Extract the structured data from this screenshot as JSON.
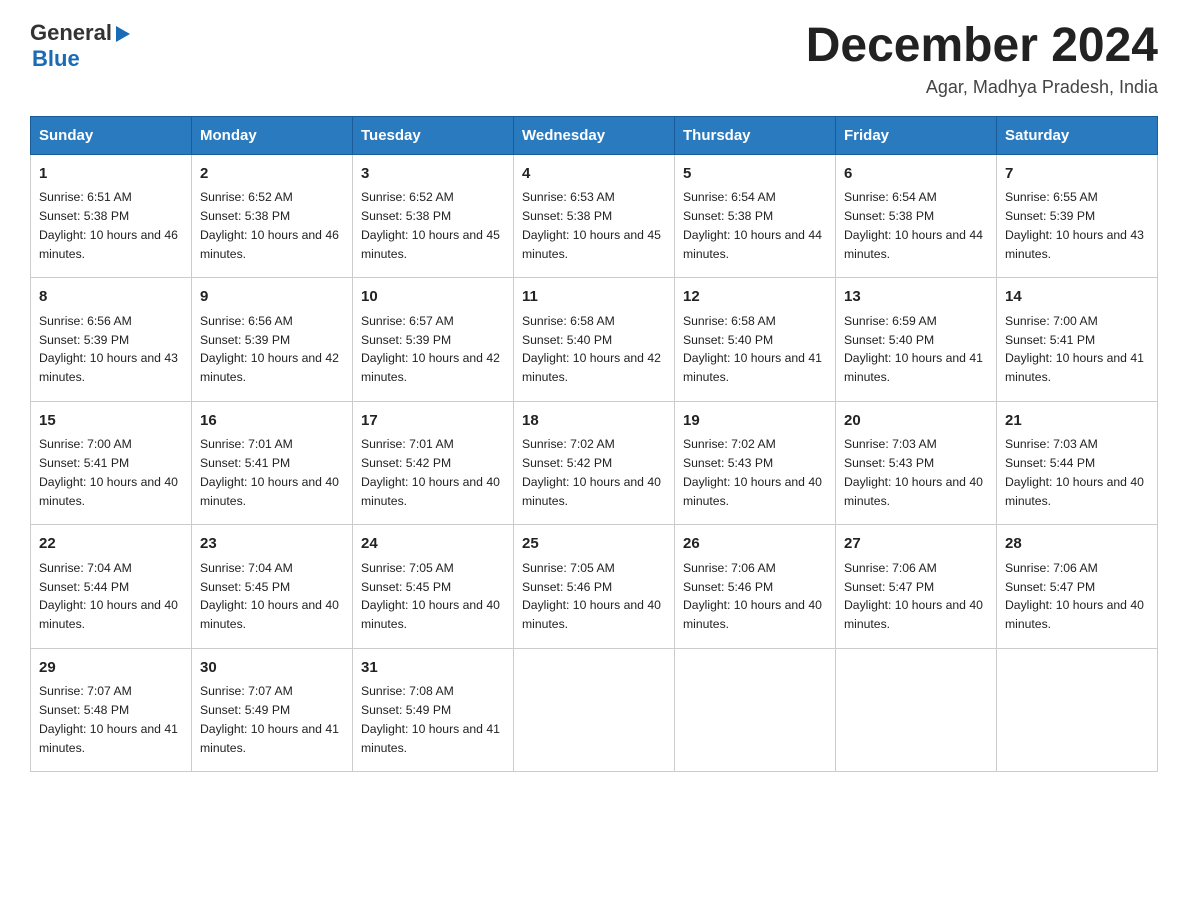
{
  "header": {
    "logo_general": "General",
    "logo_blue": "Blue",
    "month_title": "December 2024",
    "location": "Agar, Madhya Pradesh, India"
  },
  "days_of_week": [
    "Sunday",
    "Monday",
    "Tuesday",
    "Wednesday",
    "Thursday",
    "Friday",
    "Saturday"
  ],
  "weeks": [
    [
      {
        "day": "1",
        "sunrise": "6:51 AM",
        "sunset": "5:38 PM",
        "daylight": "10 hours and 46 minutes."
      },
      {
        "day": "2",
        "sunrise": "6:52 AM",
        "sunset": "5:38 PM",
        "daylight": "10 hours and 46 minutes."
      },
      {
        "day": "3",
        "sunrise": "6:52 AM",
        "sunset": "5:38 PM",
        "daylight": "10 hours and 45 minutes."
      },
      {
        "day": "4",
        "sunrise": "6:53 AM",
        "sunset": "5:38 PM",
        "daylight": "10 hours and 45 minutes."
      },
      {
        "day": "5",
        "sunrise": "6:54 AM",
        "sunset": "5:38 PM",
        "daylight": "10 hours and 44 minutes."
      },
      {
        "day": "6",
        "sunrise": "6:54 AM",
        "sunset": "5:38 PM",
        "daylight": "10 hours and 44 minutes."
      },
      {
        "day": "7",
        "sunrise": "6:55 AM",
        "sunset": "5:39 PM",
        "daylight": "10 hours and 43 minutes."
      }
    ],
    [
      {
        "day": "8",
        "sunrise": "6:56 AM",
        "sunset": "5:39 PM",
        "daylight": "10 hours and 43 minutes."
      },
      {
        "day": "9",
        "sunrise": "6:56 AM",
        "sunset": "5:39 PM",
        "daylight": "10 hours and 42 minutes."
      },
      {
        "day": "10",
        "sunrise": "6:57 AM",
        "sunset": "5:39 PM",
        "daylight": "10 hours and 42 minutes."
      },
      {
        "day": "11",
        "sunrise": "6:58 AM",
        "sunset": "5:40 PM",
        "daylight": "10 hours and 42 minutes."
      },
      {
        "day": "12",
        "sunrise": "6:58 AM",
        "sunset": "5:40 PM",
        "daylight": "10 hours and 41 minutes."
      },
      {
        "day": "13",
        "sunrise": "6:59 AM",
        "sunset": "5:40 PM",
        "daylight": "10 hours and 41 minutes."
      },
      {
        "day": "14",
        "sunrise": "7:00 AM",
        "sunset": "5:41 PM",
        "daylight": "10 hours and 41 minutes."
      }
    ],
    [
      {
        "day": "15",
        "sunrise": "7:00 AM",
        "sunset": "5:41 PM",
        "daylight": "10 hours and 40 minutes."
      },
      {
        "day": "16",
        "sunrise": "7:01 AM",
        "sunset": "5:41 PM",
        "daylight": "10 hours and 40 minutes."
      },
      {
        "day": "17",
        "sunrise": "7:01 AM",
        "sunset": "5:42 PM",
        "daylight": "10 hours and 40 minutes."
      },
      {
        "day": "18",
        "sunrise": "7:02 AM",
        "sunset": "5:42 PM",
        "daylight": "10 hours and 40 minutes."
      },
      {
        "day": "19",
        "sunrise": "7:02 AM",
        "sunset": "5:43 PM",
        "daylight": "10 hours and 40 minutes."
      },
      {
        "day": "20",
        "sunrise": "7:03 AM",
        "sunset": "5:43 PM",
        "daylight": "10 hours and 40 minutes."
      },
      {
        "day": "21",
        "sunrise": "7:03 AM",
        "sunset": "5:44 PM",
        "daylight": "10 hours and 40 minutes."
      }
    ],
    [
      {
        "day": "22",
        "sunrise": "7:04 AM",
        "sunset": "5:44 PM",
        "daylight": "10 hours and 40 minutes."
      },
      {
        "day": "23",
        "sunrise": "7:04 AM",
        "sunset": "5:45 PM",
        "daylight": "10 hours and 40 minutes."
      },
      {
        "day": "24",
        "sunrise": "7:05 AM",
        "sunset": "5:45 PM",
        "daylight": "10 hours and 40 minutes."
      },
      {
        "day": "25",
        "sunrise": "7:05 AM",
        "sunset": "5:46 PM",
        "daylight": "10 hours and 40 minutes."
      },
      {
        "day": "26",
        "sunrise": "7:06 AM",
        "sunset": "5:46 PM",
        "daylight": "10 hours and 40 minutes."
      },
      {
        "day": "27",
        "sunrise": "7:06 AM",
        "sunset": "5:47 PM",
        "daylight": "10 hours and 40 minutes."
      },
      {
        "day": "28",
        "sunrise": "7:06 AM",
        "sunset": "5:47 PM",
        "daylight": "10 hours and 40 minutes."
      }
    ],
    [
      {
        "day": "29",
        "sunrise": "7:07 AM",
        "sunset": "5:48 PM",
        "daylight": "10 hours and 41 minutes."
      },
      {
        "day": "30",
        "sunrise": "7:07 AM",
        "sunset": "5:49 PM",
        "daylight": "10 hours and 41 minutes."
      },
      {
        "day": "31",
        "sunrise": "7:08 AM",
        "sunset": "5:49 PM",
        "daylight": "10 hours and 41 minutes."
      },
      null,
      null,
      null,
      null
    ]
  ],
  "labels": {
    "sunrise": "Sunrise:",
    "sunset": "Sunset:",
    "daylight": "Daylight:"
  }
}
